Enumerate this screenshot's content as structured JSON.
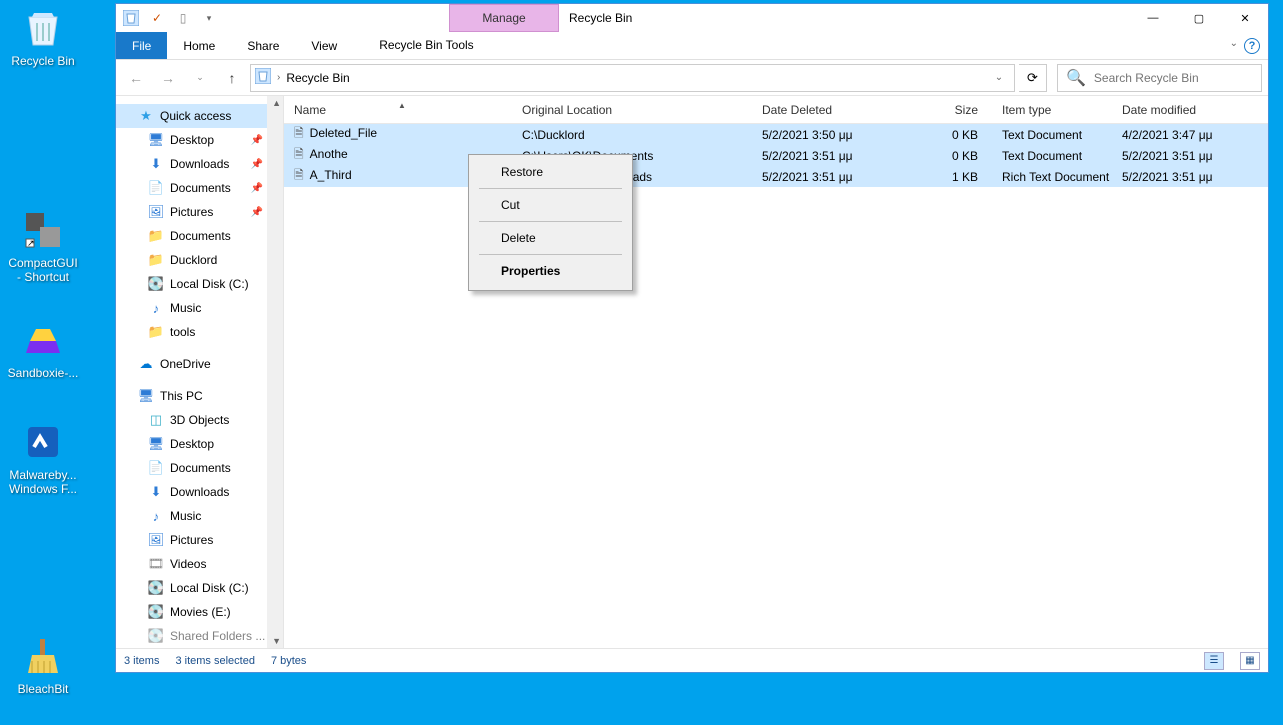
{
  "desktop": {
    "icons": [
      {
        "name": "Recycle Bin"
      },
      {
        "name": "CompactGUI - Shortcut"
      },
      {
        "name": "Sandboxie-..."
      },
      {
        "name": "Malwareby... Windows F..."
      },
      {
        "name": "BleachBit"
      }
    ]
  },
  "window": {
    "title": "Recycle Bin",
    "ribbon_context": "Manage",
    "ribbon_tool_tab": "Recycle Bin Tools",
    "tabs": {
      "file": "File",
      "home": "Home",
      "share": "Share",
      "view": "View"
    },
    "min": "—",
    "max": "▢",
    "close": "✕"
  },
  "nav": {
    "back": "←",
    "forward": "→",
    "up": "↑",
    "breadcrumb": "Recycle Bin",
    "search_placeholder": "Search Recycle Bin"
  },
  "sidebar": {
    "quick_access": "Quick access",
    "items_qa": [
      "Desktop",
      "Downloads",
      "Documents",
      "Pictures",
      "Documents",
      "Ducklord",
      "Local Disk (C:)",
      "Music",
      "tools"
    ],
    "onedrive": "OneDrive",
    "this_pc": "This PC",
    "items_pc": [
      "3D Objects",
      "Desktop",
      "Documents",
      "Downloads",
      "Music",
      "Pictures",
      "Videos",
      "Local Disk (C:)",
      "Movies (E:)",
      "Shared Folders ..."
    ]
  },
  "columns": {
    "name": "Name",
    "loc": "Original Location",
    "del": "Date Deleted",
    "size": "Size",
    "type": "Item type",
    "mod": "Date modified"
  },
  "files": [
    {
      "name": "Deleted_File",
      "loc": "C:\\Ducklord",
      "del": "5/2/2021 3:50 μμ",
      "size": "0 KB",
      "type": "Text Document",
      "mod": "4/2/2021 3:47 μμ"
    },
    {
      "name": "Anothe",
      "loc": "C:\\Users\\OK\\Documents",
      "del": "5/2/2021 3:51 μμ",
      "size": "0 KB",
      "type": "Text Document",
      "mod": "5/2/2021 3:51 μμ"
    },
    {
      "name": "A_Third",
      "loc": "C:\\Users\\OK\\Downloads",
      "del": "5/2/2021 3:51 μμ",
      "size": "1 KB",
      "type": "Rich Text Document",
      "mod": "5/2/2021 3:51 μμ"
    }
  ],
  "context_menu": {
    "restore": "Restore",
    "cut": "Cut",
    "delete": "Delete",
    "properties": "Properties"
  },
  "status": {
    "count": "3 items",
    "selected": "3 items selected",
    "bytes": "7 bytes"
  }
}
